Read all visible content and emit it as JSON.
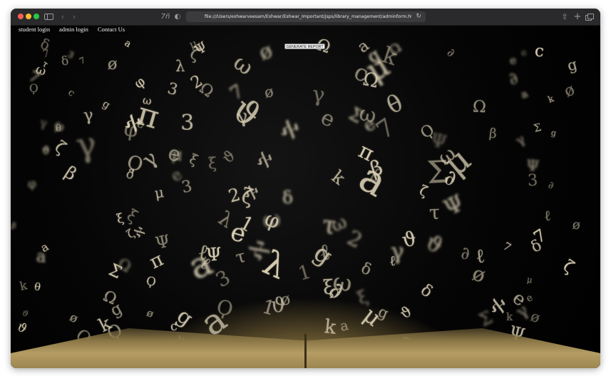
{
  "browser": {
    "url": "file:///Users/eshwarveesam/Eshwar/Eshwar_Important/jsps/library_management/adminform.html",
    "icons": [
      "close-dot",
      "minimize-dot",
      "maximize-dot",
      "sidebar-icon",
      "back-icon",
      "forward-icon",
      "extension-icon",
      "shield-icon",
      "reload-icon",
      "share-icon",
      "new-tab-icon",
      "tab-overview-icon"
    ],
    "back_glyph": "‹",
    "forward_glyph": "›",
    "extension_glyph": "7ñ",
    "shield_glyph": "◐",
    "reload_glyph": "↻",
    "share_glyph": "⇧",
    "plus_glyph": "+"
  },
  "page": {
    "nav": {
      "student_login": "student login",
      "admin_login": "admin login",
      "contact_us": "Contact Us"
    },
    "generate_report_label": "GENERATE REPORT",
    "background": {
      "description_icon": "flying-letters-book-image",
      "glyphs": [
        "Σ",
        "ω",
        "β",
        "δ",
        "Ψ",
        "φ",
        "Ϙ",
        "π",
        "θ",
        "λ",
        "ζ",
        "ξ",
        "μ",
        "3",
        "7",
        "2",
        "1",
        "g",
        "k",
        "c",
        "a",
        "e",
        "ℓ",
        "∂",
        "ø",
        "Ω",
        "γ",
        "ϑ",
        "τ",
        "ℵ"
      ]
    }
  },
  "colors": {
    "titlebar": "#2a2a2c",
    "page_background": "#000000",
    "nav_text": "#f0f0f0",
    "glyph": "#d9cfb4",
    "book": "#a38d55"
  }
}
